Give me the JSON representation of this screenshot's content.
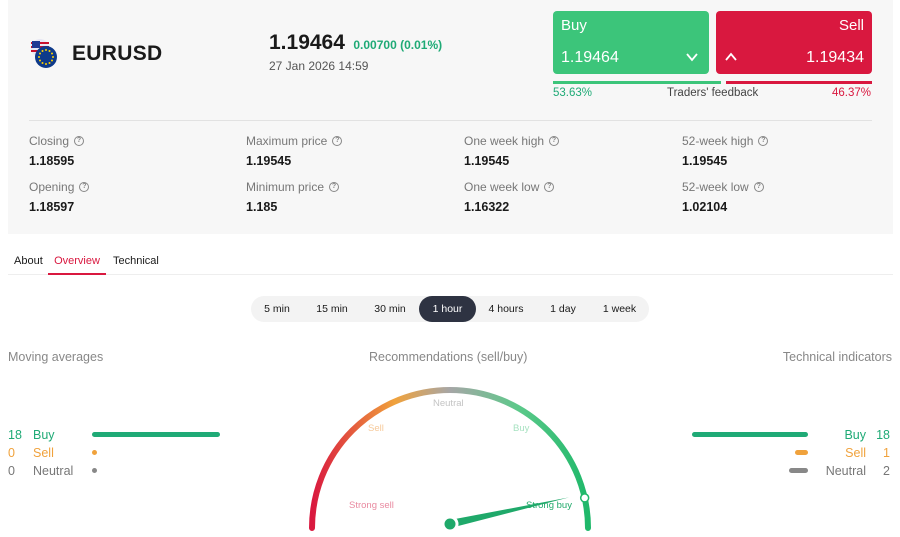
{
  "instrument": {
    "symbol": "EURUSD",
    "price": "1.19464",
    "change": "0.00700 (0.01%)",
    "datetime": "27 Jan 2026 14:59"
  },
  "trade": {
    "buy_label": "Buy",
    "buy_price": "1.19464",
    "sell_label": "Sell",
    "sell_price": "1.19434"
  },
  "feedback": {
    "buy_pct": "53.63%",
    "label": "Traders' feedback",
    "sell_pct": "46.37%",
    "buy_fraction": 0.5363
  },
  "stats": {
    "closing": {
      "label": "Closing",
      "value": "1.18595"
    },
    "max_price": {
      "label": "Maximum price",
      "value": "1.19545"
    },
    "week_high": {
      "label": "One week high",
      "value": "1.19545"
    },
    "high_52": {
      "label": "52-week high",
      "value": "1.19545"
    },
    "opening": {
      "label": "Opening",
      "value": "1.18597"
    },
    "min_price": {
      "label": "Minimum price",
      "value": "1.185"
    },
    "week_low": {
      "label": "One week low",
      "value": "1.16322"
    },
    "low_52": {
      "label": "52-week low",
      "value": "1.02104"
    }
  },
  "tabs": [
    {
      "label": "About"
    },
    {
      "label": "Overview"
    },
    {
      "label": "Technical"
    }
  ],
  "active_tab": "Overview",
  "timeframes": [
    {
      "label": "5 min"
    },
    {
      "label": "15 min"
    },
    {
      "label": "30 min"
    },
    {
      "label": "1 hour"
    },
    {
      "label": "4 hours"
    },
    {
      "label": "1 day"
    },
    {
      "label": "1 week"
    }
  ],
  "active_timeframe": "1 hour",
  "moving_averages": {
    "title": "Moving averages",
    "buy": {
      "count": "18",
      "label": "Buy"
    },
    "sell": {
      "count": "0",
      "label": "Sell"
    },
    "neutral": {
      "count": "0",
      "label": "Neutral"
    }
  },
  "recommendations": {
    "title": "Recommendations (sell/buy)",
    "labels": {
      "strong_sell": "Strong sell",
      "sell": "Sell",
      "neutral": "Neutral",
      "buy": "Buy",
      "strong_buy": "Strong buy"
    },
    "needle_fraction": 0.93
  },
  "technical_indicators": {
    "title": "Technical indicators",
    "buy": {
      "count": "18",
      "label": "Buy"
    },
    "sell": {
      "count": "1",
      "label": "Sell"
    },
    "neutral": {
      "count": "2",
      "label": "Neutral"
    }
  },
  "colors": {
    "buy": "#3cc57a",
    "buy_text": "#1faa76",
    "sell": "#d9183f",
    "sell_orange": "#f0a23c",
    "neutral": "#999999",
    "dark": "#2e3342"
  }
}
